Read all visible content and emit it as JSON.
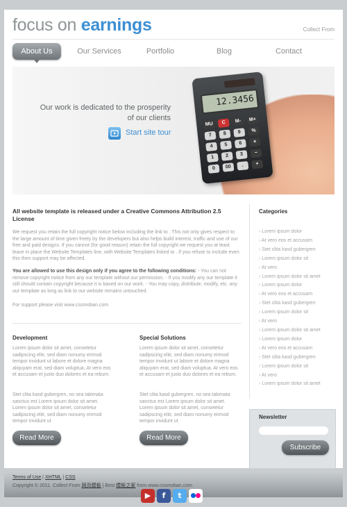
{
  "header": {
    "logo_part1": "focus on",
    "logo_part2": "earnings",
    "collect_link": "Collect From"
  },
  "nav": [
    {
      "label": "About Us",
      "active": true
    },
    {
      "label": "Our Services",
      "active": false
    },
    {
      "label": "Portfolio",
      "active": false
    },
    {
      "label": "Blog",
      "active": false
    },
    {
      "label": "Contact",
      "active": false
    }
  ],
  "hero": {
    "tagline_line1": "Our work is dedicated to the prosperity",
    "tagline_line2": "of our clients",
    "tour_label": "Start site tour",
    "calc_display": "12.3456"
  },
  "main": {
    "title": "All website template is released under a Creative Commons Attribution 2.5 License",
    "para1": "We request you retain the full copyright notice below including the link to . This not only gives respect to the large amount of time given freely by the developers but also helps build interest, traffic and use of our free and paid designs. If you cannot (for good reason) retain the full copyright we request you at least leave in place the Website Templates line, with Website Templates linked to . If you refuse to include even this then support may be affected.",
    "para2_bold": "You are allowed to use this design only if you agree to the following conditions:",
    "para2_rest": " - You can not remove copyright notice from any our template without our permission. - If you modify any our template it still should contain copyright because it is based on our work. - You may copy, distribute, modify, etc. any our template as long as link to our website remains untouched.",
    "para3": "For support please visit www.cssmoban.com",
    "development": {
      "title": "Development",
      "text1": "Lorem ipsum dolor sit amet, consetetur sadipscing elitr, sed diam nonumy eirmod tempor invidunt ut labore et dolore magna aliquyam erat, sed diam voluptua. At vero eos et accusam et justo duo dolores et ea rebum.",
      "text2": "Stet clita kasd gubergren, no sea takimata sanctus est Lorem ipsum dolor sit amet. Lorem ipsum dolor sit amet, consetetur sadipscing elitr, sed diam nonumy eirmod tempor invidunt ut",
      "button": "Read More"
    },
    "special": {
      "title": "Special Solutions",
      "text1": "Lorem ipsum dolor sit amet, consetetur sadipscing elitr, sed diam nonumy eirmod tempor invidunt ut labore et dolore magna aliquyam erat, sed diam voluptua. At vero eos et accusam et justo duo dolores et ea rebum.",
      "text2": "Stet clita kasd gubergren, no sea takimata sanctus est Lorem ipsum dolor sit amet. Lorem ipsum dolor sit amet, consetetur sadipscing elitr, sed diam nonumy eirmod tempor invidunt ut",
      "button": "Read More"
    }
  },
  "sidebar": {
    "categories_title": "Categories",
    "categories": [
      "Lorem ipsum dolor",
      "At vero eos et accusam",
      "Stet clita kasd gubergren",
      "Lorem ipsum dolor sit",
      "At vero",
      "Lorem ipsum dolor sit amet",
      "Lorem ipsum dolor",
      "At vero eos et accusam",
      "Stet clita kasd gubergren",
      "Lorem ipsum dolor sit",
      "At vero",
      "Lorem ipsum dolor sit amet",
      "Lorem ipsum dolor",
      "At vero eos et accusam",
      "Stet clita kasd gubergren",
      "Lorem ipsum dolor sit",
      "At vero",
      "Lorem ipsum dolor sit amet"
    ],
    "newsletter_title": "Newsletter",
    "newsletter_input_value": "",
    "subscribe": "Subscribe"
  },
  "footer": {
    "terms": "Terms of Use",
    "xhtml": "XHTML",
    "css": "CSS",
    "copyright_pre": "Copyright © 2011. Collect From",
    "link1": "网页模板",
    "mid": " | Best",
    "link2": "模板之家",
    "post": "from www.cssmoban.com"
  },
  "social_icons": [
    "youtube-icon",
    "facebook-icon",
    "twitter-icon",
    "flickr-icon"
  ]
}
